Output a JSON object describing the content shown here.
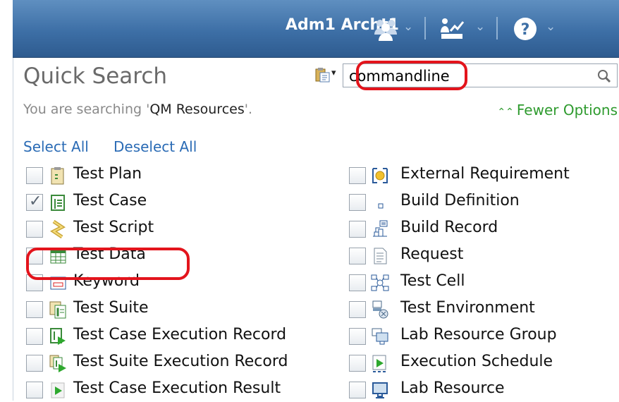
{
  "header": {
    "user_name": "Adm1 Archt1",
    "icons": [
      "people-icon",
      "dashboard-icon",
      "help-icon"
    ]
  },
  "quick_search": {
    "title": "Quick Search",
    "query": "commandline",
    "scope_prefix": "You are searching '",
    "scope_name": "QM Resources",
    "scope_suffix": "'.",
    "fewer_options": "Fewer Options",
    "select_all": "Select All",
    "deselect_all": "Deselect All"
  },
  "left_options": [
    {
      "label": "Test Plan",
      "checked": false,
      "icon": "test-plan-icon"
    },
    {
      "label": "Test Case",
      "checked": true,
      "icon": "test-case-icon"
    },
    {
      "label": "Test Script",
      "checked": false,
      "icon": "test-script-icon"
    },
    {
      "label": "Test Data",
      "checked": false,
      "icon": "test-data-icon"
    },
    {
      "label": "Keyword",
      "checked": false,
      "icon": "keyword-icon"
    },
    {
      "label": "Test Suite",
      "checked": false,
      "icon": "test-suite-icon"
    },
    {
      "label": "Test Case Execution Record",
      "checked": false,
      "icon": "test-case-execution-record-icon"
    },
    {
      "label": "Test Suite Execution Record",
      "checked": false,
      "icon": "test-suite-execution-record-icon"
    },
    {
      "label": "Test Case Execution Result",
      "checked": false,
      "icon": "test-case-execution-result-icon"
    }
  ],
  "right_options": [
    {
      "label": "External Requirement",
      "checked": false,
      "icon": "external-requirement-icon"
    },
    {
      "label": "Build Definition",
      "checked": false,
      "icon": "build-definition-icon"
    },
    {
      "label": "Build Record",
      "checked": false,
      "icon": "build-record-icon"
    },
    {
      "label": "Request",
      "checked": false,
      "icon": "request-icon"
    },
    {
      "label": "Test Cell",
      "checked": false,
      "icon": "test-cell-icon"
    },
    {
      "label": "Test Environment",
      "checked": false,
      "icon": "test-environment-icon"
    },
    {
      "label": "Lab Resource Group",
      "checked": false,
      "icon": "lab-resource-group-icon"
    },
    {
      "label": "Execution Schedule",
      "checked": false,
      "icon": "execution-schedule-icon"
    },
    {
      "label": "Lab Resource",
      "checked": false,
      "icon": "lab-resource-icon"
    }
  ],
  "colors": {
    "header_blue": "#3d6fa6",
    "link_blue": "#2a6bb5",
    "fewer_green": "#2f9b2f",
    "highlight_red": "#e3141c"
  }
}
